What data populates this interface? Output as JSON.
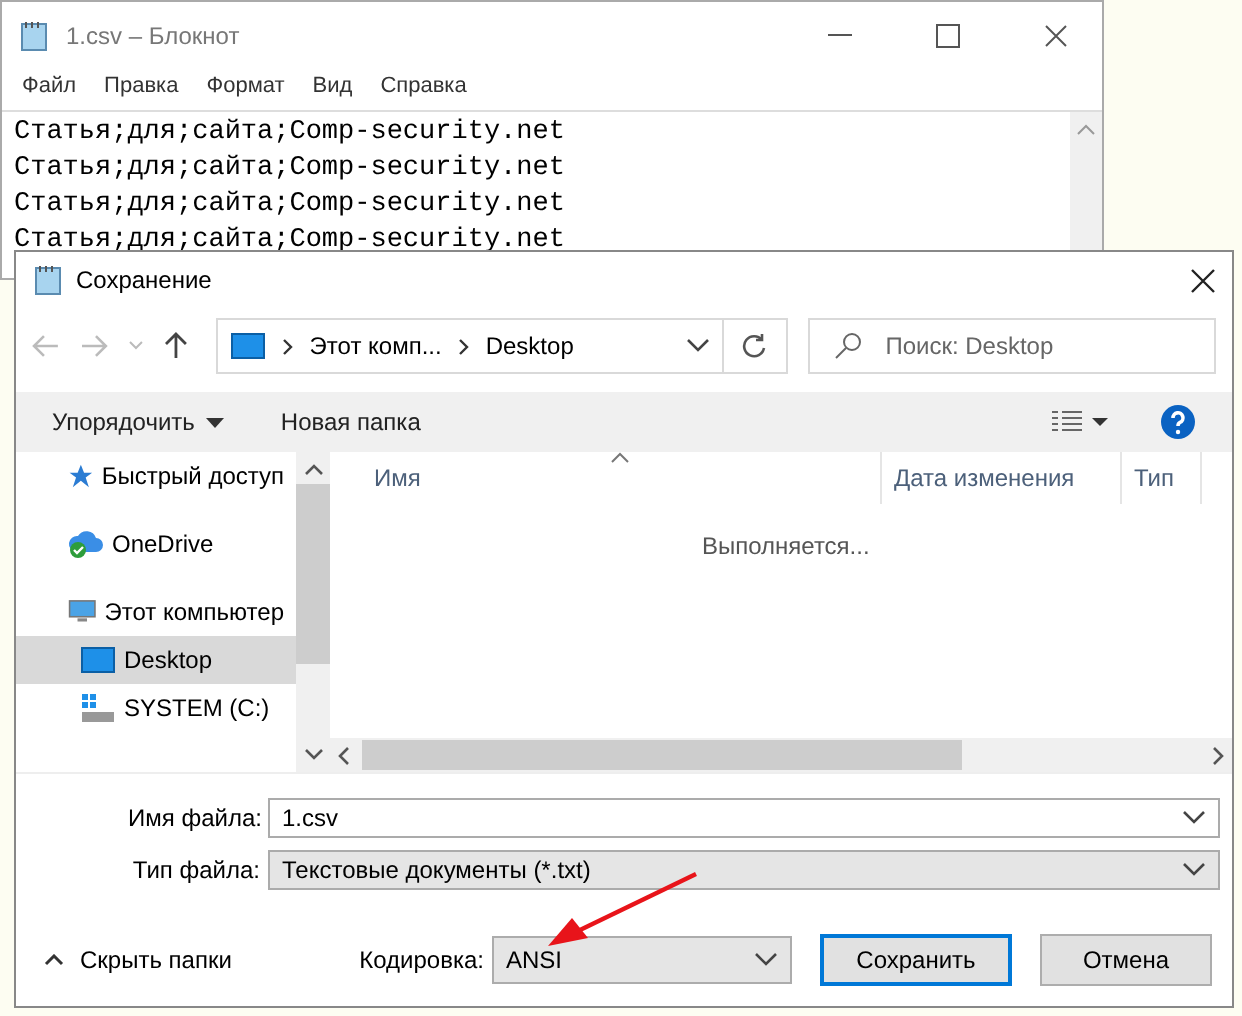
{
  "notepad": {
    "title": "1.csv – Блокнот",
    "menu": [
      "Файл",
      "Правка",
      "Формат",
      "Вид",
      "Справка"
    ],
    "lines": [
      "Статья;для;сайта;Comp-security.net",
      "Статья;для;сайта;Comp-security.net",
      "Статья;для;сайта;Comp-security.net",
      "Статья;для;сайта;Comp-security.net"
    ]
  },
  "dialog": {
    "title": "Сохранение",
    "breadcrumb": [
      "Этот комп...",
      "Desktop"
    ],
    "search": {
      "placeholder": "Поиск: Desktop"
    },
    "toolbar": {
      "organize": "Упорядочить",
      "new_folder": "Новая папка"
    },
    "nav_items": [
      {
        "label": "Быстрый доступ",
        "kind": "star",
        "selected": false
      },
      {
        "label": "OneDrive",
        "kind": "cloud",
        "selected": false
      },
      {
        "label": "Этот компьютер",
        "kind": "pc",
        "selected": false,
        "children": [
          {
            "label": "Desktop",
            "kind": "desktop",
            "selected": true
          },
          {
            "label": "SYSTEM (C:)",
            "kind": "drive",
            "selected": false
          }
        ]
      }
    ],
    "columns": [
      "Имя",
      "Дата изменения",
      "Тип"
    ],
    "status": "Выполняется...",
    "filename": {
      "label": "Имя файла:",
      "value": "1.csv"
    },
    "filetype": {
      "label": "Тип файла:",
      "value": "Текстовые документы (*.txt)"
    },
    "hide_folders": "Скрыть папки",
    "encoding": {
      "label": "Кодировка:",
      "value": "ANSI"
    },
    "buttons": [
      "Сохранить",
      "Отмена"
    ]
  }
}
